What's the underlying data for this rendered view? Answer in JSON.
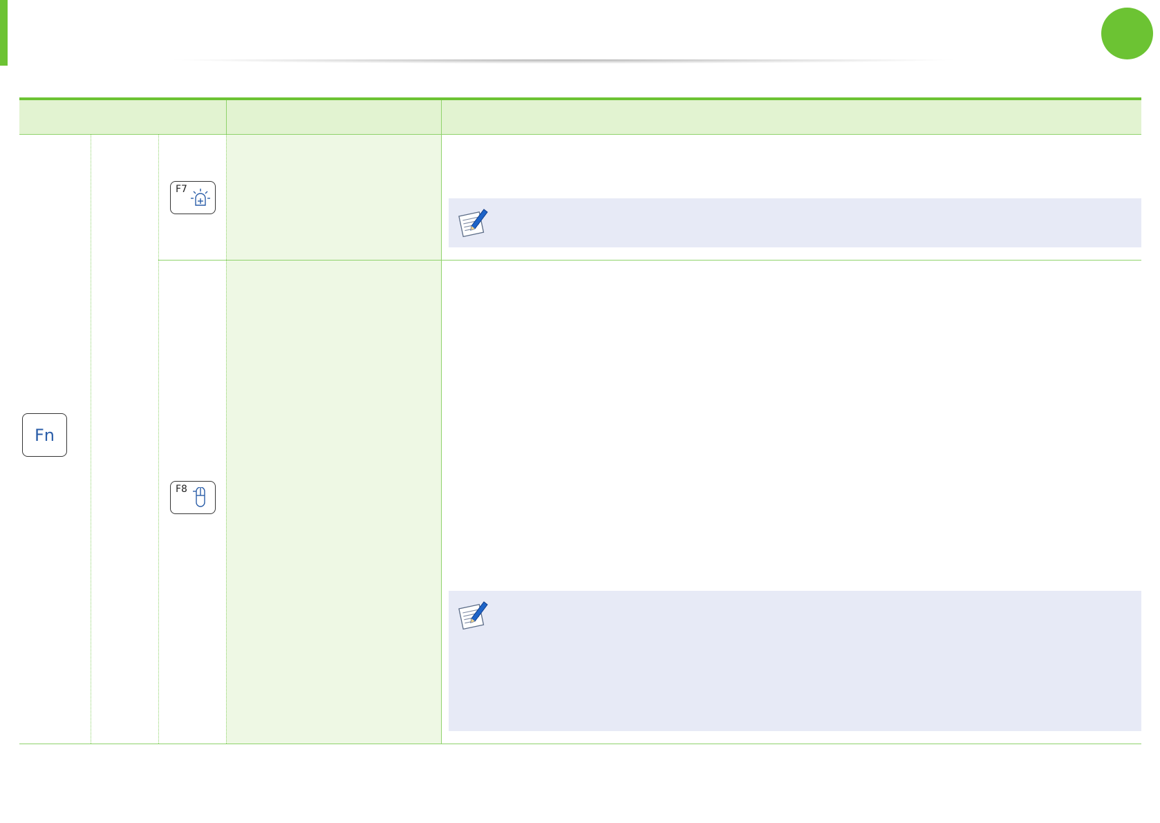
{
  "colors": {
    "accent_green": "#6cc333",
    "header_fill": "#e2f3d1",
    "function_column_fill": "#eef8e4",
    "rule_line": "#8ed26a",
    "note_fill": "#e7eaf6",
    "key_text_blue": "#2a5da8"
  },
  "table": {
    "modifier_key": {
      "label": "Fn"
    },
    "rows": [
      {
        "key_label": "F7",
        "key_icon": "backlight-icon",
        "has_note": true,
        "note_icon": "note-pen-icon"
      },
      {
        "key_label": "F8",
        "key_icon": "touchpad-icon",
        "has_note": true,
        "note_icon": "note-pen-icon"
      }
    ]
  }
}
